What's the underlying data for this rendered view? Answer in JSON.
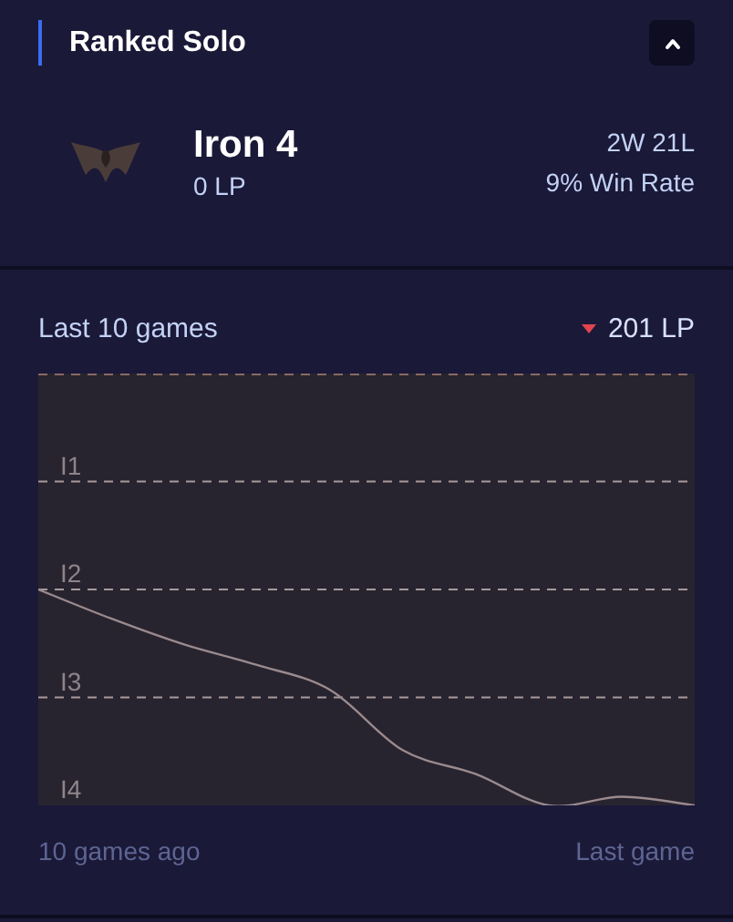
{
  "header": {
    "title": "Ranked Solo",
    "expanded": true
  },
  "rank": {
    "tier": "Iron 4",
    "lp": "0 LP",
    "record": "2W 21L",
    "win_rate": "9% Win Rate"
  },
  "recent": {
    "title": "Last 10 games",
    "change": {
      "decrease": true,
      "text": "201 LP"
    },
    "tier_lines": [
      "I1",
      "I2",
      "I3",
      "I4"
    ],
    "start_label": "10 games ago",
    "end_label": "Last game"
  }
}
